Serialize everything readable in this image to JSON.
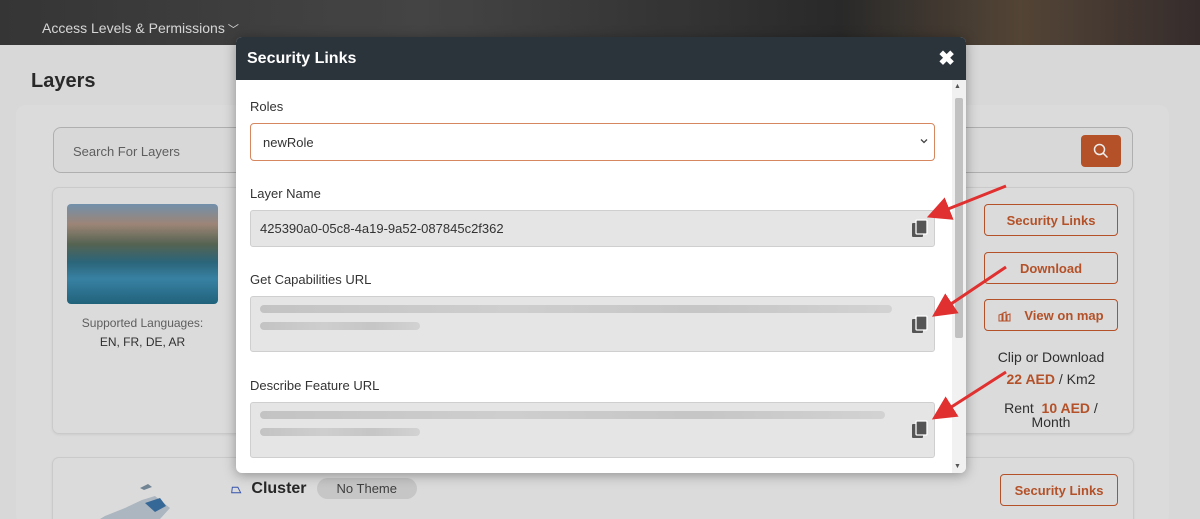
{
  "banner": {
    "menu_label": "Access Levels & Permissions",
    "menu_chevron": "﹀"
  },
  "page": {
    "title": "Layers"
  },
  "search": {
    "placeholder": "Search For Layers"
  },
  "card1": {
    "supported_languages_label": "Supported Languages:",
    "languages": "EN, FR, DE, AR",
    "buttons": {
      "security_links": "Security Links",
      "download": "Download",
      "view_on_map": "View on map"
    },
    "clip_label": "Clip or Download",
    "clip_price": "22 AED",
    "clip_unit": " / Km2",
    "rent_label": "Rent",
    "rent_price": "10 AED",
    "rent_unit": " / Month"
  },
  "card2": {
    "title": "Cluster",
    "theme": "No Theme",
    "buttons": {
      "security_links": "Security Links"
    }
  },
  "modal": {
    "title": "Security Links",
    "close_glyph": "✖",
    "roles_label": "Roles",
    "roles_selected": "newRole",
    "layer_name_label": "Layer Name",
    "layer_name_value": "425390a0-05c8-4a19-9a52-087845c2f362",
    "get_capabilities_label": "Get Capabilities URL",
    "describe_feature_label": "Describe Feature URL"
  },
  "colors": {
    "accent": "#c2582c",
    "modal_header": "#2b333b",
    "arrow": "#e03030"
  }
}
